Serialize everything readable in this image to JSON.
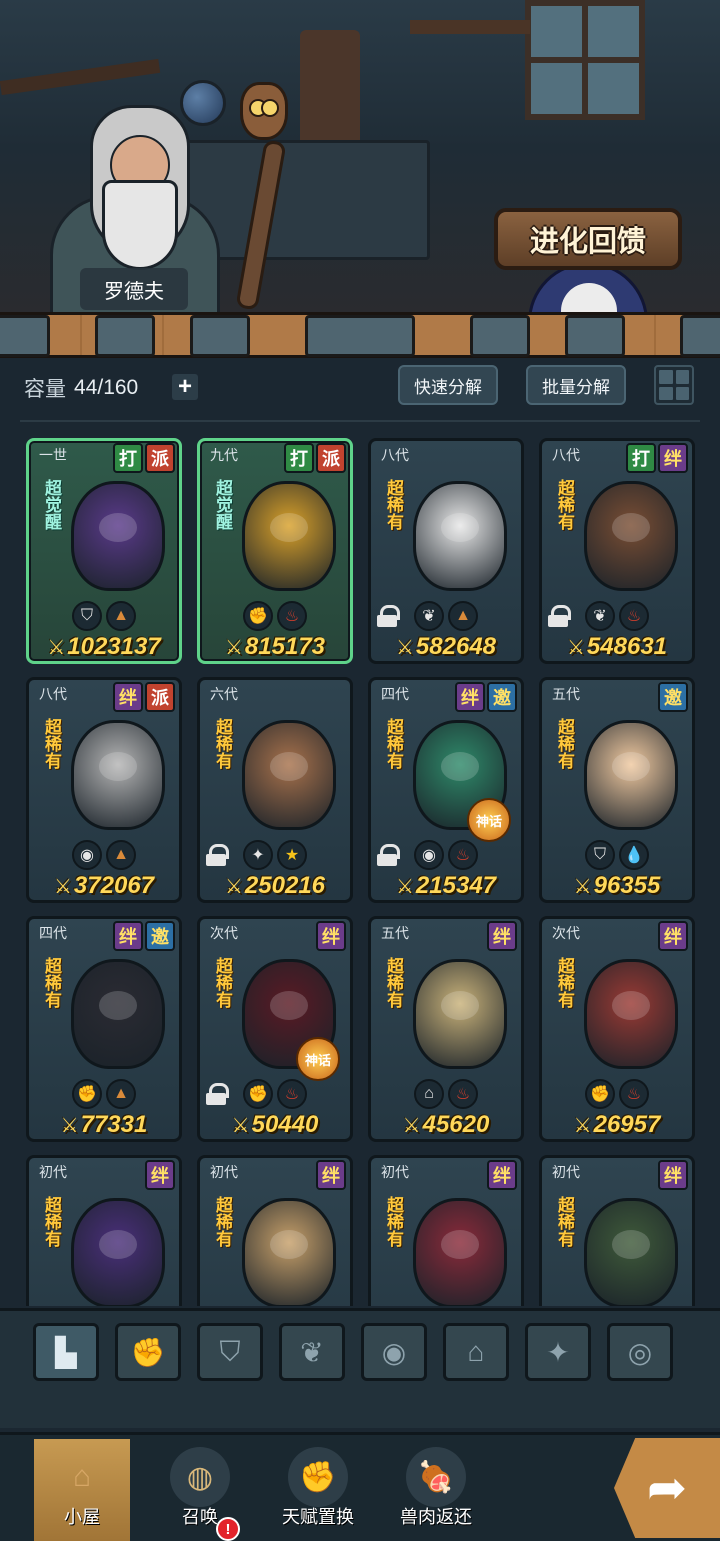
{
  "scene": {
    "npc_name": "罗德夫",
    "evolve_feedback": "进化回馈"
  },
  "toolbar": {
    "capacity_label": "容量",
    "capacity_value": "44/160",
    "add_symbol": "+",
    "quick_decompose": "快速分解",
    "batch_decompose": "批量分解"
  },
  "cards": [
    {
      "gen": "一世",
      "badges": [
        "打",
        "派"
      ],
      "rarity": "超觉醒",
      "power": "1023137",
      "traits": [
        "shield-icon",
        "rock-icon"
      ],
      "locked": false,
      "myth": false,
      "color": "#5a3a8a"
    },
    {
      "gen": "九代",
      "badges": [
        "打",
        "派"
      ],
      "rarity": "超觉醒",
      "power": "815173",
      "traits": [
        "fist-icon",
        "fire-icon"
      ],
      "locked": false,
      "myth": false,
      "color": "#d9a12a"
    },
    {
      "gen": "八代",
      "badges": [],
      "rarity": "超稀有",
      "power": "582648",
      "traits": [
        "sprout-icon",
        "rock-icon"
      ],
      "locked": true,
      "myth": false,
      "color": "#e8e8e8"
    },
    {
      "gen": "八代",
      "badges": [
        "打",
        "绊"
      ],
      "rarity": "超稀有",
      "power": "548631",
      "traits": [
        "sprout-icon",
        "fire-icon"
      ],
      "locked": true,
      "myth": false,
      "color": "#7a4e34"
    },
    {
      "gen": "八代",
      "badges": [
        "绊",
        "派"
      ],
      "rarity": "超稀有",
      "power": "372067",
      "traits": [
        "ghost-icon",
        "rock-icon"
      ],
      "locked": false,
      "myth": false,
      "color": "#b5b5b5"
    },
    {
      "gen": "六代",
      "badges": [],
      "rarity": "超稀有",
      "power": "250216",
      "traits": [
        "crosshair-icon",
        "star-icon"
      ],
      "locked": true,
      "myth": false,
      "color": "#a8724c"
    },
    {
      "gen": "四代",
      "badges": [
        "绊",
        "邀"
      ],
      "rarity": "超稀有",
      "power": "215347",
      "traits": [
        "ghost-icon",
        "fire-icon"
      ],
      "locked": true,
      "myth": true,
      "color": "#2f8a6a"
    },
    {
      "gen": "五代",
      "badges": [
        "邀"
      ],
      "rarity": "超稀有",
      "power": "96355",
      "traits": [
        "shield-icon",
        "water-icon"
      ],
      "locked": false,
      "myth": false,
      "color": "#f0c9a0"
    },
    {
      "gen": "四代",
      "badges": [
        "绊",
        "邀"
      ],
      "rarity": "超稀有",
      "power": "77331",
      "traits": [
        "fist-icon",
        "rock-icon"
      ],
      "locked": false,
      "myth": false,
      "color": "#2b2b33"
    },
    {
      "gen": "次代",
      "badges": [
        "绊"
      ],
      "rarity": "超稀有",
      "power": "50440",
      "traits": [
        "fist-icon",
        "fire-icon"
      ],
      "locked": true,
      "myth": true,
      "color": "#5a1a24"
    },
    {
      "gen": "五代",
      "badges": [
        "绊"
      ],
      "rarity": "超稀有",
      "power": "45620",
      "traits": [
        "temple-icon",
        "fire-icon"
      ],
      "locked": false,
      "myth": false,
      "color": "#c9b27a"
    },
    {
      "gen": "次代",
      "badges": [
        "绊"
      ],
      "rarity": "超稀有",
      "power": "26957",
      "traits": [
        "fist-icon",
        "fire-icon"
      ],
      "locked": false,
      "myth": false,
      "color": "#9a3a34"
    },
    {
      "gen": "初代",
      "badges": [
        "绊"
      ],
      "rarity": "超稀有",
      "power": "",
      "traits": [],
      "locked": false,
      "myth": false,
      "color": "#4a2f7a"
    },
    {
      "gen": "初代",
      "badges": [
        "绊"
      ],
      "rarity": "超稀有",
      "power": "",
      "traits": [],
      "locked": false,
      "myth": false,
      "color": "#c7a06a"
    },
    {
      "gen": "初代",
      "badges": [
        "绊"
      ],
      "rarity": "超稀有",
      "power": "",
      "traits": [],
      "locked": false,
      "myth": false,
      "color": "#8a2a3a"
    },
    {
      "gen": "初代",
      "badges": [
        "绊"
      ],
      "rarity": "超稀有",
      "power": "",
      "traits": [],
      "locked": false,
      "myth": false,
      "color": "#3f5a3a"
    }
  ],
  "myth_label": "神话",
  "filters": [
    {
      "icon": "stack-icon",
      "glyph": "▙",
      "active": true
    },
    {
      "icon": "fist-icon",
      "glyph": "✊",
      "active": false
    },
    {
      "icon": "shield-icon",
      "glyph": "⛉",
      "active": false
    },
    {
      "icon": "sprout-icon",
      "glyph": "❦",
      "active": false
    },
    {
      "icon": "ghost-icon",
      "glyph": "◉",
      "active": false
    },
    {
      "icon": "temple-icon",
      "glyph": "⌂",
      "active": false
    },
    {
      "icon": "crosshair-icon",
      "glyph": "✦",
      "active": false
    },
    {
      "icon": "swirl-icon",
      "glyph": "◎",
      "active": false
    }
  ],
  "nav": [
    {
      "id": "cabin",
      "label": "小屋",
      "active": true,
      "alert": false,
      "glyph": "⌂",
      "color": "#d7a766"
    },
    {
      "id": "summon",
      "label": "召唤",
      "active": false,
      "alert": true,
      "glyph": "◍",
      "color": "#d9b87a"
    },
    {
      "id": "talent",
      "label": "天赋置换",
      "active": false,
      "alert": false,
      "glyph": "✊",
      "color": "#c99a5a"
    },
    {
      "id": "meat",
      "label": "兽肉返还",
      "active": false,
      "alert": false,
      "glyph": "🍖",
      "color": "#d98a6a"
    }
  ],
  "alert_symbol": "!",
  "next_arrow": "➦",
  "trait_glyphs": {
    "shield-icon": "⛉",
    "rock-icon": "▲",
    "fist-icon": "✊",
    "fire-icon": "♨",
    "sprout-icon": "❦",
    "ghost-icon": "◉",
    "crosshair-icon": "✦",
    "star-icon": "★",
    "water-icon": "💧",
    "temple-icon": "⌂"
  },
  "trait_colors": {
    "rock-icon": "#d98a3a",
    "fire-icon": "#e2402c",
    "star-icon": "#f5c21a",
    "water-icon": "#3aa0d9"
  }
}
